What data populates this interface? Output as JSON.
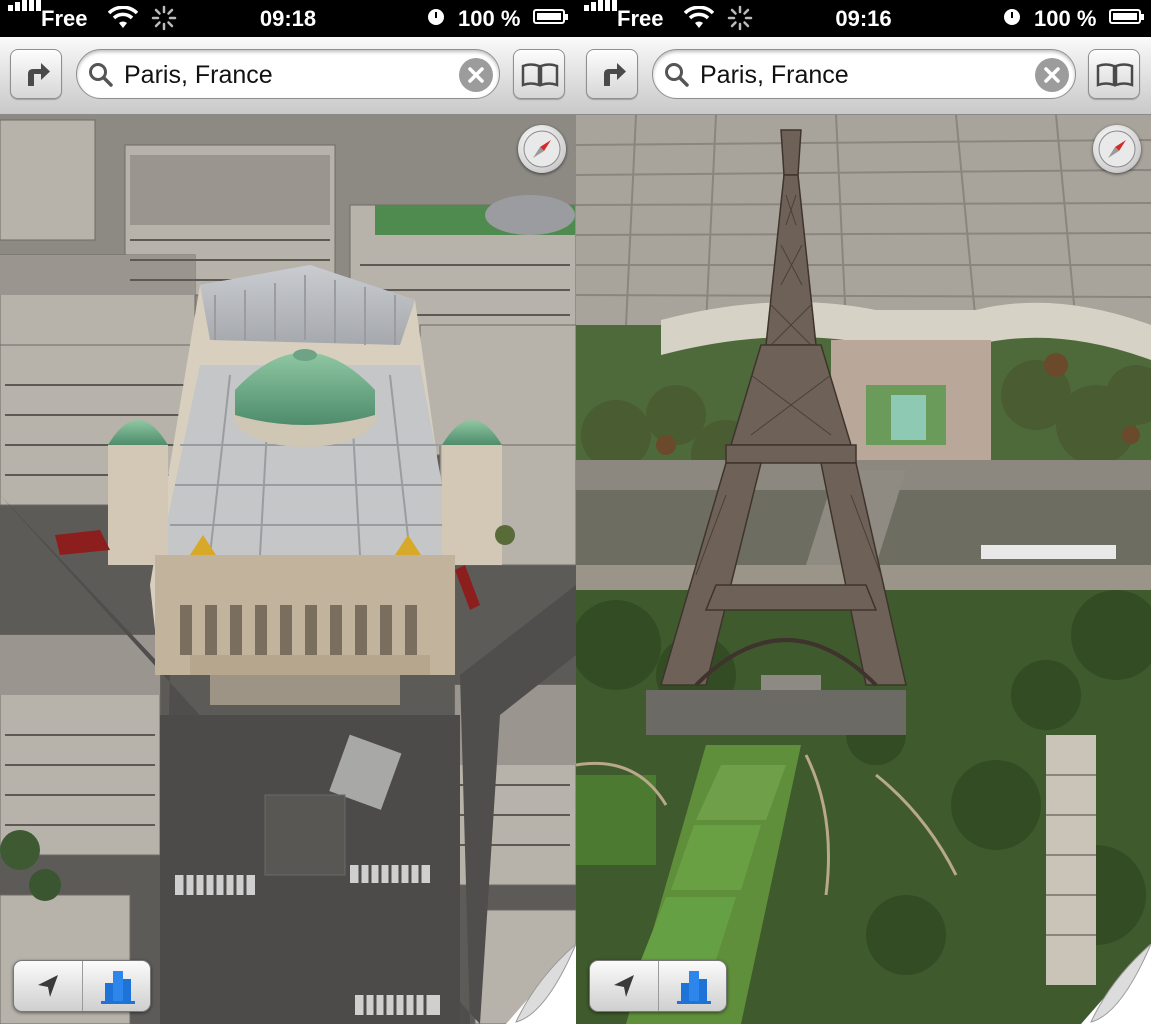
{
  "screens": [
    {
      "status": {
        "carrier": "Free",
        "time": "09:18",
        "battery": "100 %"
      },
      "search": {
        "text": "Paris, France"
      },
      "map": {
        "landmark": "Opéra Garnier",
        "mode": "3D flyover"
      }
    },
    {
      "status": {
        "carrier": "Free",
        "time": "09:16",
        "battery": "100 %"
      },
      "search": {
        "text": "Paris, France"
      },
      "map": {
        "landmark": "Eiffel Tower",
        "mode": "3D flyover"
      }
    }
  ],
  "icons": {
    "directions": "turn-right-arrow-icon",
    "bookmarks": "open-book-icon",
    "search": "magnifier-icon",
    "clear": "clear-x-icon",
    "compass": "compass-icon",
    "location": "location-arrow-icon",
    "buildings": "3d-buildings-icon"
  },
  "colors": {
    "accent_blue": "#1e73d6",
    "compass_red": "#d32a2a",
    "toolbar_top": "#fafafa",
    "toolbar_bottom": "#c9c9c9"
  }
}
